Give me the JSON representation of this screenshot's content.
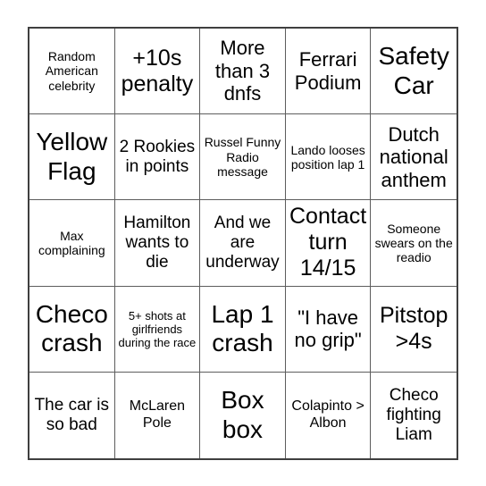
{
  "card": {
    "type": "bingo-card",
    "columns": 5,
    "rows": 5,
    "background_color": "#ffffff",
    "text_color": "#000000",
    "outer_border_color": "#3f3f3f",
    "gridline_color": "#5d5d5d",
    "cells": [
      {
        "text": "Random American celebrity",
        "size": "xs"
      },
      {
        "text": "+10s penalty",
        "size": "xl"
      },
      {
        "text": "More than 3 dnfs",
        "size": "lg"
      },
      {
        "text": "Ferrari Podium",
        "size": "lg"
      },
      {
        "text": "Safety Car",
        "size": "xxl"
      },
      {
        "text": "Yellow Flag",
        "size": "xxl"
      },
      {
        "text": "2 Rookies in points",
        "size": "md"
      },
      {
        "text": "Russel Funny Radio message",
        "size": "xs"
      },
      {
        "text": "Lando looses position lap 1",
        "size": "xs"
      },
      {
        "text": "Dutch national anthem",
        "size": "lg"
      },
      {
        "text": "Max complaining",
        "size": "xs"
      },
      {
        "text": "Hamilton wants to die",
        "size": "md"
      },
      {
        "text": "And we are underway",
        "size": "md"
      },
      {
        "text": "Contact turn 14/15",
        "size": "xl"
      },
      {
        "text": "Someone swears on the readio",
        "size": "xs"
      },
      {
        "text": "Checo crash",
        "size": "xxl"
      },
      {
        "text": "5+ shots at girlfriends during the race",
        "size": "xxs"
      },
      {
        "text": "Lap 1 crash",
        "size": "xxl"
      },
      {
        "text": "\"I have no grip\"",
        "size": "lg"
      },
      {
        "text": "Pitstop >4s",
        "size": "xl"
      },
      {
        "text": "The car is so bad",
        "size": "md"
      },
      {
        "text": "McLaren Pole",
        "size": "sm"
      },
      {
        "text": "Box box",
        "size": "xxl"
      },
      {
        "text": "Colapinto > Albon",
        "size": "sm"
      },
      {
        "text": "Checo fighting Liam",
        "size": "md"
      }
    ]
  }
}
